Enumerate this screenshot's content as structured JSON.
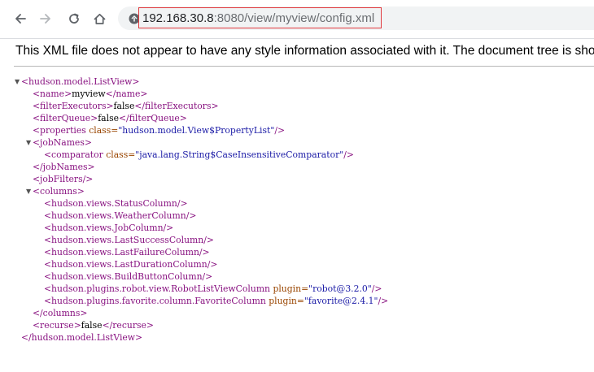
{
  "browser": {
    "url_host": "192.168.30.8",
    "url_rest": ":8080/view/myview/config.xml"
  },
  "page": {
    "info_message": "This XML file does not appear to have any style information associated with it. The document tree is shown below."
  },
  "xml": {
    "root_open": "<hudson.model.ListView>",
    "name_open": "<name>",
    "name_value": "myview",
    "name_close": "</name>",
    "filter_executors_open": "<filterExecutors>",
    "filter_executors_value": "false",
    "filter_executors_close": "</filterExecutors>",
    "filter_queue_open": "<filterQueue>",
    "filter_queue_value": "false",
    "filter_queue_close": "</filterQueue>",
    "properties_open": "<properties",
    "properties_attr": " class=",
    "properties_val": "\"hudson.model.View$PropertyList\"",
    "properties_close": "/>",
    "jobnames_open": "<jobNames>",
    "comparator_open": "<comparator",
    "comparator_attr": " class=",
    "comparator_val": "\"java.lang.String$CaseInsensitiveComparator\"",
    "comparator_close": "/>",
    "jobnames_close": "</jobNames>",
    "jobfilters": "<jobFilters/>",
    "columns_open": "<columns>",
    "col_status": "<hudson.views.StatusColumn/>",
    "col_weather": "<hudson.views.WeatherColumn/>",
    "col_job": "<hudson.views.JobColumn/>",
    "col_last_success": "<hudson.views.LastSuccessColumn/>",
    "col_last_failure": "<hudson.views.LastFailureColumn/>",
    "col_last_duration": "<hudson.views.LastDurationColumn/>",
    "col_build_button": "<hudson.views.BuildButtonColumn/>",
    "robot_open": "<hudson.plugins.robot.view.RobotListViewColumn",
    "robot_attr": " plugin=",
    "robot_val": "\"robot@3.2.0\"",
    "robot_close": "/>",
    "favorite_open": "<hudson.plugins.favorite.column.FavoriteColumn",
    "favorite_attr": " plugin=",
    "favorite_val": "\"favorite@2.4.1\"",
    "favorite_close": "/>",
    "columns_close": "</columns>",
    "recurse_open": "<recurse>",
    "recurse_value": "false",
    "recurse_close": "</recurse>",
    "root_close": "</hudson.model.ListView>",
    "toggle_glyph": "▼"
  },
  "icons": {
    "back": "back-arrow-icon",
    "forward": "forward-arrow-icon",
    "reload": "reload-icon",
    "home": "home-icon",
    "site_info": "site-info-icon"
  },
  "colors": {
    "tag": "#881280",
    "attribute": "#994500",
    "value": "#1a1aa6",
    "url_highlight_border": "#e0393d"
  }
}
